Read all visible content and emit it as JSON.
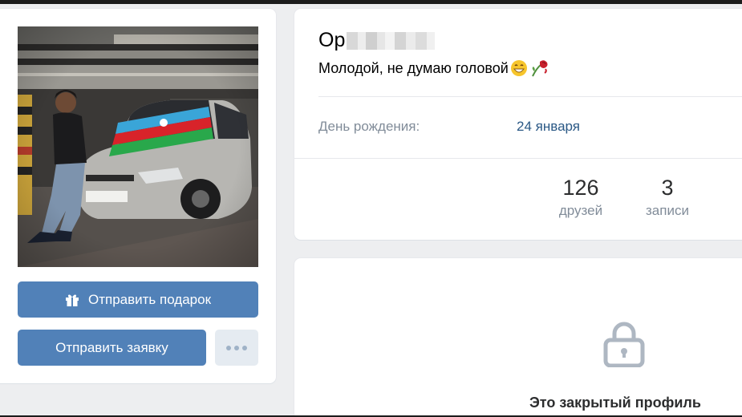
{
  "profile": {
    "name_visible": "Ор",
    "status": "Молодой, не думаю головой",
    "status_emojis": [
      "grinning-face-emoji",
      "wilted-rose-emoji"
    ],
    "birthday_label": "День рождения:",
    "birthday_value": "24 января"
  },
  "counters": {
    "friends_count": "126",
    "friends_label": "друзей",
    "posts_count": "3",
    "posts_label": "записи"
  },
  "actions": {
    "gift_label": "Отправить подарок",
    "request_label": "Отправить заявку",
    "more_icon": "more-horizontal-icon"
  },
  "private": {
    "lock_icon": "lock-icon",
    "text": "Это закрытый профиль"
  },
  "colors": {
    "accent": "#5181b8",
    "link": "#2a5885",
    "secondary_text": "#818c99",
    "page_bg": "#edeef0"
  }
}
